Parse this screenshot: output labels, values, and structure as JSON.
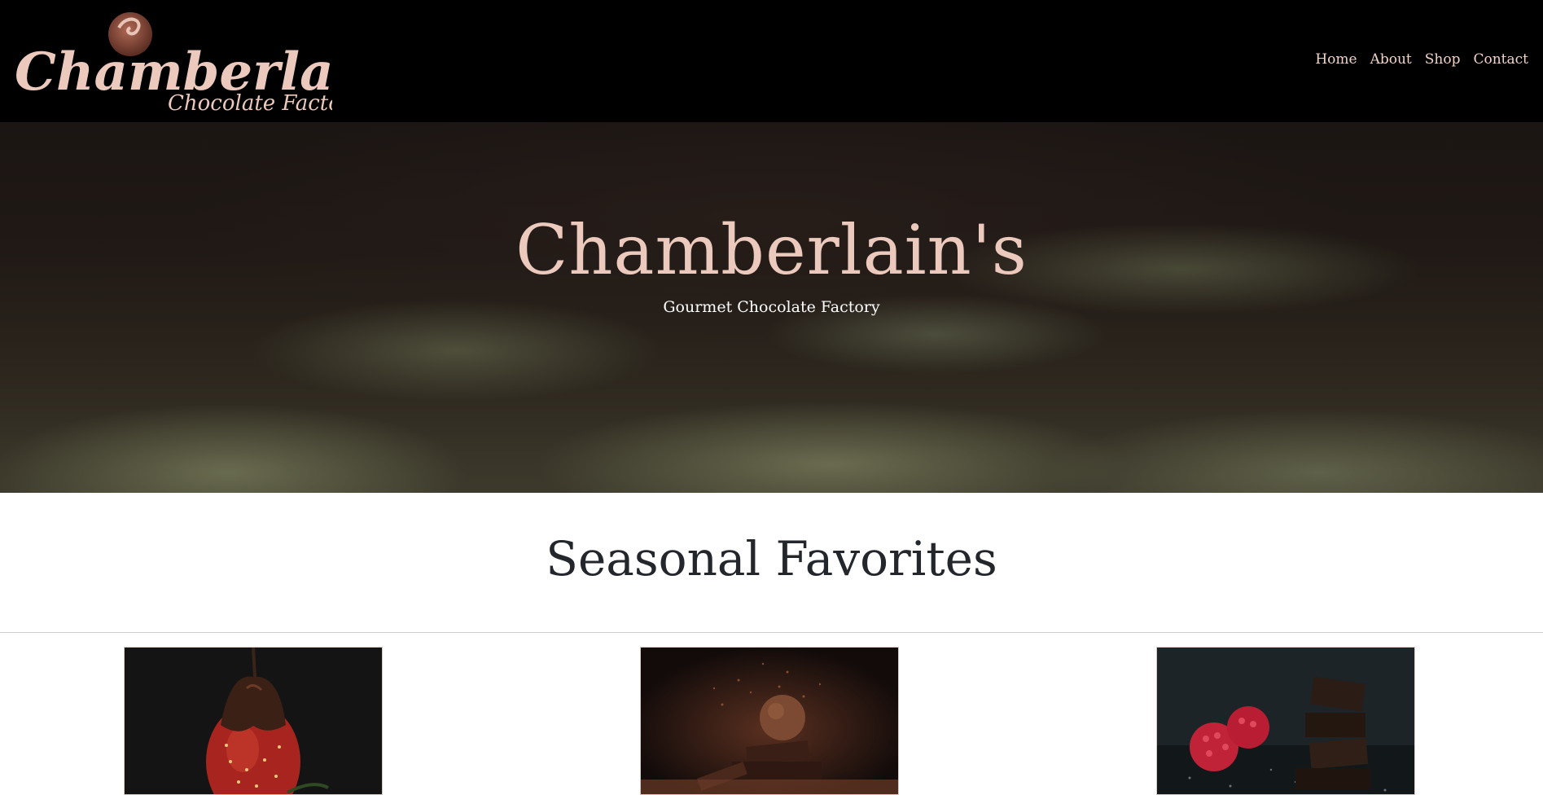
{
  "navbar": {
    "brand": {
      "logo_name": "Chamberlain's",
      "logo_tagline": "Chocolate Factory"
    },
    "links": [
      {
        "label": "Home"
      },
      {
        "label": "About"
      },
      {
        "label": "Shop"
      },
      {
        "label": "Contact"
      }
    ]
  },
  "hero": {
    "title": "Chamberlain's",
    "subtitle": "Gourmet Chocolate Factory"
  },
  "seasonal": {
    "heading": "Seasonal Favorites",
    "cards": [
      {
        "image": "chocolate-dipped-strawberry"
      },
      {
        "image": "cocoa-truffle-on-chocolate-pieces"
      },
      {
        "image": "raspberries-and-dark-chocolate-stack"
      }
    ]
  },
  "colors": {
    "accent_pink": "#ecc9bd",
    "navbar_bg": "#000000",
    "heading_text": "#23262b"
  }
}
